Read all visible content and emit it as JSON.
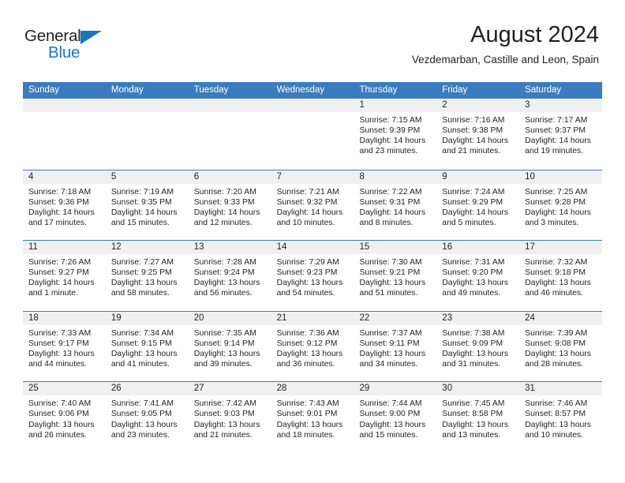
{
  "brand": {
    "name_part1": "General",
    "name_part2": "Blue",
    "primary_color": "#1b75bb",
    "triangle_icon": "triangle-icon"
  },
  "header": {
    "month_title": "August 2024",
    "location": "Vezdemarban, Castille and Leon, Spain"
  },
  "calendar": {
    "header_color": "#3b7cbe",
    "daynum_band_color": "#f0f0f0",
    "weekdays": [
      "Sunday",
      "Monday",
      "Tuesday",
      "Wednesday",
      "Thursday",
      "Friday",
      "Saturday"
    ],
    "weeks": [
      [
        {
          "day": "",
          "lines": []
        },
        {
          "day": "",
          "lines": []
        },
        {
          "day": "",
          "lines": []
        },
        {
          "day": "",
          "lines": []
        },
        {
          "day": "1",
          "lines": [
            "Sunrise: 7:15 AM",
            "Sunset: 9:39 PM",
            "Daylight: 14 hours",
            "and 23 minutes."
          ]
        },
        {
          "day": "2",
          "lines": [
            "Sunrise: 7:16 AM",
            "Sunset: 9:38 PM",
            "Daylight: 14 hours",
            "and 21 minutes."
          ]
        },
        {
          "day": "3",
          "lines": [
            "Sunrise: 7:17 AM",
            "Sunset: 9:37 PM",
            "Daylight: 14 hours",
            "and 19 minutes."
          ]
        }
      ],
      [
        {
          "day": "4",
          "lines": [
            "Sunrise: 7:18 AM",
            "Sunset: 9:36 PM",
            "Daylight: 14 hours",
            "and 17 minutes."
          ]
        },
        {
          "day": "5",
          "lines": [
            "Sunrise: 7:19 AM",
            "Sunset: 9:35 PM",
            "Daylight: 14 hours",
            "and 15 minutes."
          ]
        },
        {
          "day": "6",
          "lines": [
            "Sunrise: 7:20 AM",
            "Sunset: 9:33 PM",
            "Daylight: 14 hours",
            "and 12 minutes."
          ]
        },
        {
          "day": "7",
          "lines": [
            "Sunrise: 7:21 AM",
            "Sunset: 9:32 PM",
            "Daylight: 14 hours",
            "and 10 minutes."
          ]
        },
        {
          "day": "8",
          "lines": [
            "Sunrise: 7:22 AM",
            "Sunset: 9:31 PM",
            "Daylight: 14 hours",
            "and 8 minutes."
          ]
        },
        {
          "day": "9",
          "lines": [
            "Sunrise: 7:24 AM",
            "Sunset: 9:29 PM",
            "Daylight: 14 hours",
            "and 5 minutes."
          ]
        },
        {
          "day": "10",
          "lines": [
            "Sunrise: 7:25 AM",
            "Sunset: 9:28 PM",
            "Daylight: 14 hours",
            "and 3 minutes."
          ]
        }
      ],
      [
        {
          "day": "11",
          "lines": [
            "Sunrise: 7:26 AM",
            "Sunset: 9:27 PM",
            "Daylight: 14 hours",
            "and 1 minute."
          ]
        },
        {
          "day": "12",
          "lines": [
            "Sunrise: 7:27 AM",
            "Sunset: 9:25 PM",
            "Daylight: 13 hours",
            "and 58 minutes."
          ]
        },
        {
          "day": "13",
          "lines": [
            "Sunrise: 7:28 AM",
            "Sunset: 9:24 PM",
            "Daylight: 13 hours",
            "and 56 minutes."
          ]
        },
        {
          "day": "14",
          "lines": [
            "Sunrise: 7:29 AM",
            "Sunset: 9:23 PM",
            "Daylight: 13 hours",
            "and 54 minutes."
          ]
        },
        {
          "day": "15",
          "lines": [
            "Sunrise: 7:30 AM",
            "Sunset: 9:21 PM",
            "Daylight: 13 hours",
            "and 51 minutes."
          ]
        },
        {
          "day": "16",
          "lines": [
            "Sunrise: 7:31 AM",
            "Sunset: 9:20 PM",
            "Daylight: 13 hours",
            "and 49 minutes."
          ]
        },
        {
          "day": "17",
          "lines": [
            "Sunrise: 7:32 AM",
            "Sunset: 9:18 PM",
            "Daylight: 13 hours",
            "and 46 minutes."
          ]
        }
      ],
      [
        {
          "day": "18",
          "lines": [
            "Sunrise: 7:33 AM",
            "Sunset: 9:17 PM",
            "Daylight: 13 hours",
            "and 44 minutes."
          ]
        },
        {
          "day": "19",
          "lines": [
            "Sunrise: 7:34 AM",
            "Sunset: 9:15 PM",
            "Daylight: 13 hours",
            "and 41 minutes."
          ]
        },
        {
          "day": "20",
          "lines": [
            "Sunrise: 7:35 AM",
            "Sunset: 9:14 PM",
            "Daylight: 13 hours",
            "and 39 minutes."
          ]
        },
        {
          "day": "21",
          "lines": [
            "Sunrise: 7:36 AM",
            "Sunset: 9:12 PM",
            "Daylight: 13 hours",
            "and 36 minutes."
          ]
        },
        {
          "day": "22",
          "lines": [
            "Sunrise: 7:37 AM",
            "Sunset: 9:11 PM",
            "Daylight: 13 hours",
            "and 34 minutes."
          ]
        },
        {
          "day": "23",
          "lines": [
            "Sunrise: 7:38 AM",
            "Sunset: 9:09 PM",
            "Daylight: 13 hours",
            "and 31 minutes."
          ]
        },
        {
          "day": "24",
          "lines": [
            "Sunrise: 7:39 AM",
            "Sunset: 9:08 PM",
            "Daylight: 13 hours",
            "and 28 minutes."
          ]
        }
      ],
      [
        {
          "day": "25",
          "lines": [
            "Sunrise: 7:40 AM",
            "Sunset: 9:06 PM",
            "Daylight: 13 hours",
            "and 26 minutes."
          ]
        },
        {
          "day": "26",
          "lines": [
            "Sunrise: 7:41 AM",
            "Sunset: 9:05 PM",
            "Daylight: 13 hours",
            "and 23 minutes."
          ]
        },
        {
          "day": "27",
          "lines": [
            "Sunrise: 7:42 AM",
            "Sunset: 9:03 PM",
            "Daylight: 13 hours",
            "and 21 minutes."
          ]
        },
        {
          "day": "28",
          "lines": [
            "Sunrise: 7:43 AM",
            "Sunset: 9:01 PM",
            "Daylight: 13 hours",
            "and 18 minutes."
          ]
        },
        {
          "day": "29",
          "lines": [
            "Sunrise: 7:44 AM",
            "Sunset: 9:00 PM",
            "Daylight: 13 hours",
            "and 15 minutes."
          ]
        },
        {
          "day": "30",
          "lines": [
            "Sunrise: 7:45 AM",
            "Sunset: 8:58 PM",
            "Daylight: 13 hours",
            "and 13 minutes."
          ]
        },
        {
          "day": "31",
          "lines": [
            "Sunrise: 7:46 AM",
            "Sunset: 8:57 PM",
            "Daylight: 13 hours",
            "and 10 minutes."
          ]
        }
      ]
    ]
  }
}
